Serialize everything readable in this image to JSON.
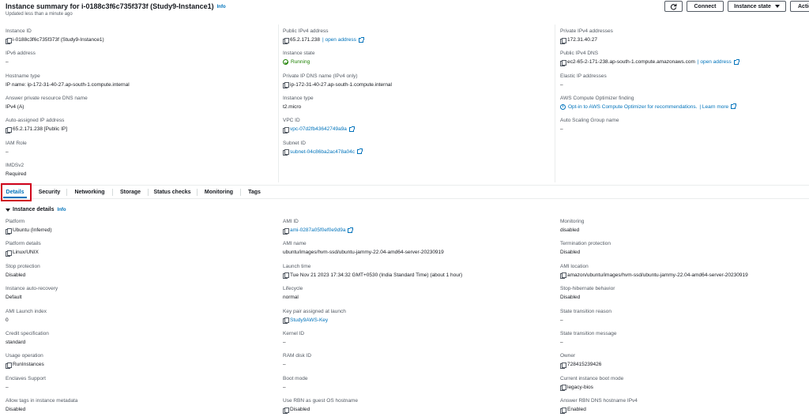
{
  "header": {
    "title": "Instance summary for i-0188c3f6c735f373f (Study9-Instance1)",
    "info": "Info",
    "updated": "Updated less than a minute ago",
    "buttons": {
      "connect": "Connect",
      "instance_state": "Instance state",
      "actions": "Actio"
    }
  },
  "summary": {
    "col1": [
      {
        "label": "Instance ID",
        "value": "i-0188c3f6c735f373f (Study9-Instance1)",
        "icon": "copy-icon"
      },
      {
        "label": "IPv6 address",
        "value": "–"
      },
      {
        "label": "Hostname type",
        "value": "IP name: ip-172-31-40-27.ap-south-1.compute.internal"
      },
      {
        "label": "Answer private resource DNS name",
        "value": "IPv4 (A)"
      },
      {
        "label": "Auto-assigned IP address",
        "value": "65.2.171.238 [Public IP]",
        "icon": "copy-icon"
      },
      {
        "label": "IAM Role",
        "value": "–"
      },
      {
        "label": "IMDSv2",
        "value": "Required"
      }
    ],
    "col2": [
      {
        "label": "Public IPv4 address",
        "value": "65.2.171.238",
        "link": "| open address",
        "icon": "copy-icon"
      },
      {
        "label": "Instance state",
        "value": "Running",
        "icon": "check-circle-icon"
      },
      {
        "label": "Private IP DNS name (IPv4 only)",
        "value": "ip-172-31-40-27.ap-south-1.compute.internal",
        "icon": "copy-icon"
      },
      {
        "label": "Instance type",
        "value": "t2.micro"
      },
      {
        "label": "VPC ID",
        "value": "vpc-07d2fb43642749a9a",
        "icon": "copy-icon"
      },
      {
        "label": "Subnet ID",
        "value": "subnet-04c86ba2ac478a04c",
        "icon": "copy-icon"
      }
    ],
    "col3": [
      {
        "label": "Private IPv4 addresses",
        "value": "172.31.40.27",
        "icon": "copy-icon"
      },
      {
        "label": "Public IPv4 DNS",
        "value": "ec2-65-2-171-238.ap-south-1.compute.amazonaws.com",
        "link": "| open address",
        "icon": "copy-icon"
      },
      {
        "label": "Elastic IP addresses",
        "value": "–"
      },
      {
        "label": "AWS Compute Optimizer finding",
        "value": "Opt-in to AWS Compute Optimizer for recommendations.",
        "link": "| Learn more",
        "icon": "info-icon"
      },
      {
        "label": "Auto Scaling Group name",
        "value": "–"
      }
    ]
  },
  "tabs": [
    "Details",
    "Security",
    "Networking",
    "Storage",
    "Status checks",
    "Monitoring",
    "Tags"
  ],
  "details": {
    "section_title": "Instance details",
    "info": "Info",
    "col1": [
      {
        "label": "Platform",
        "value": "Ubuntu (Inferred)",
        "icon": "copy-icon"
      },
      {
        "label": "Platform details",
        "value": "Linux/UNIX",
        "icon": "copy-icon"
      },
      {
        "label": "Stop protection",
        "value": "Disabled"
      },
      {
        "label": "Instance auto-recovery",
        "value": "Default"
      },
      {
        "label": "AMI Launch index",
        "value": "0"
      },
      {
        "label": "Credit specification",
        "value": "standard"
      },
      {
        "label": "Usage operation",
        "value": "RunInstances",
        "icon": "copy-icon"
      },
      {
        "label": "Enclaves Support",
        "value": "–"
      },
      {
        "label": "Allow tags in instance metadata",
        "value": "Disabled"
      }
    ],
    "col2": [
      {
        "label": "AMI ID",
        "value": "ami-0287a05f0ef0e9d9a",
        "icon": "copy-icon"
      },
      {
        "label": "AMI name",
        "value": "ubuntu/images/hvm-ssd/ubuntu-jammy-22.04-amd64-server-20230919"
      },
      {
        "label": "Launch time",
        "value": "Tue Nov 21 2023 17:34:32 GMT+0530 (India Standard Time) (about 1 hour)",
        "icon": "copy-icon"
      },
      {
        "label": "Lifecycle",
        "value": "normal"
      },
      {
        "label": "Key pair assigned at launch",
        "value": "Study9AWS-Key",
        "icon": "copy-icon"
      },
      {
        "label": "Kernel ID",
        "value": "–"
      },
      {
        "label": "RAM disk ID",
        "value": "–"
      },
      {
        "label": "Boot mode",
        "value": "–"
      },
      {
        "label": "Use RBN as guest OS hostname",
        "value": "Disabled",
        "icon": "copy-icon"
      }
    ],
    "col3": [
      {
        "label": "Monitoring",
        "value": "disabled"
      },
      {
        "label": "Termination protection",
        "value": "Disabled"
      },
      {
        "label": "AMI location",
        "value": "amazon/ubuntu/images/hvm-ssd/ubuntu-jammy-22.04-amd64-server-20230919",
        "icon": "copy-icon"
      },
      {
        "label": "Stop-hibernate behavior",
        "value": "Disabled"
      },
      {
        "label": "State transition reason",
        "value": "–"
      },
      {
        "label": "State transition message",
        "value": "–"
      },
      {
        "label": "Owner",
        "value": "728415239426",
        "icon": "copy-icon"
      },
      {
        "label": "Current instance boot mode",
        "value": "legacy-bios",
        "icon": "copy-icon"
      },
      {
        "label": "Answer RBN DNS hostname IPv4",
        "value": "Enabled",
        "icon": "copy-icon"
      }
    ]
  }
}
